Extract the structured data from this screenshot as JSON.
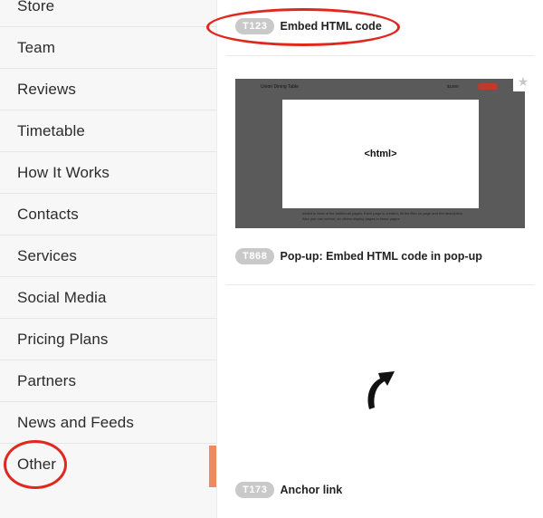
{
  "sidebar": {
    "items": [
      {
        "label": "Store"
      },
      {
        "label": "Team"
      },
      {
        "label": "Reviews"
      },
      {
        "label": "Timetable"
      },
      {
        "label": "How It Works"
      },
      {
        "label": "Contacts"
      },
      {
        "label": "Services"
      },
      {
        "label": "Social Media"
      },
      {
        "label": "Pricing Plans"
      },
      {
        "label": "Partners"
      },
      {
        "label": "News and Feeds"
      },
      {
        "label": "Other"
      }
    ],
    "active_item": "Other",
    "active_color": "#f08a5d"
  },
  "blocks": [
    {
      "code": "T123",
      "title": "Embed HTML code"
    },
    {
      "code": "T868",
      "title": "Pop-up: Embed HTML code in pop-up",
      "preview": {
        "page_title": "Union Dining Table",
        "price": "$1000",
        "box_text": "<html>",
        "body_text": "added in front of the additional pages. Each page is created, fill the files on page and the description. Also you can control, on others display pages in those pages"
      },
      "star_icon": "star-icon"
    },
    {
      "code": "T173",
      "title": "Anchor link",
      "icon": "curved-arrow-icon"
    }
  ],
  "annotations": {
    "highlight_color": "#e0281e"
  }
}
